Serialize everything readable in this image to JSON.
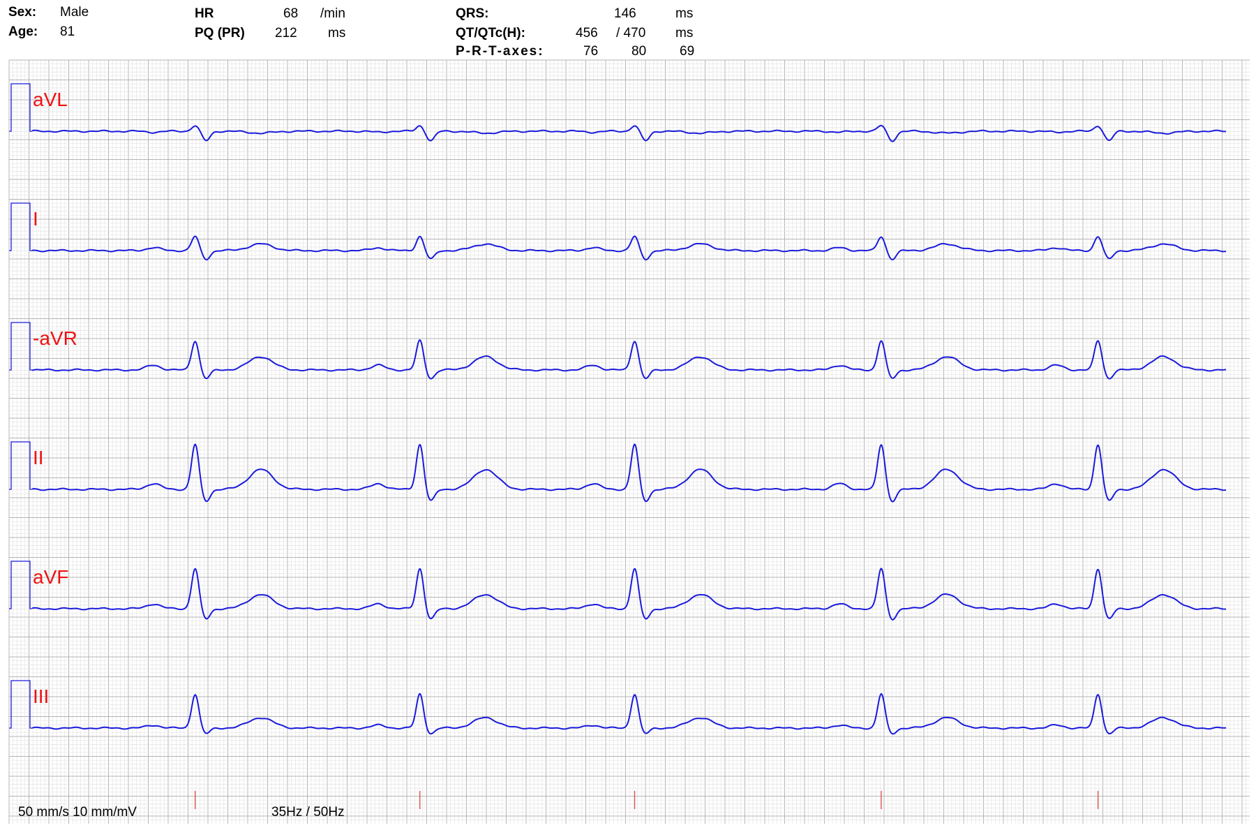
{
  "patient": {
    "sex_label": "Sex:",
    "sex": "Male",
    "age_label": "Age:",
    "age": "81"
  },
  "measurements": {
    "hr_label": "HR",
    "hr": "68",
    "hr_unit": "/min",
    "pq_label": "PQ (PR)",
    "pq": "212",
    "pq_unit": "ms",
    "qrs_label": "QRS:",
    "qrs": "146",
    "qrs_unit": "ms",
    "qt_label": "QT/QTc(H):",
    "qt": "456",
    "qtc": "/ 470",
    "qt_unit": "ms",
    "axes_label": "P-R-T-axes:",
    "p_axis": "76",
    "r_axis": "80",
    "t_axis": "69"
  },
  "footer": {
    "speed_gain": "50 mm/s 10 mm/mV",
    "filter": "35Hz / 50Hz"
  },
  "colors": {
    "trace": "#1a1adc",
    "label": "#ee1111",
    "grid_minor": "#e3e3e3",
    "grid_major": "#b4b4b4",
    "marker": "#e04848"
  },
  "chart_data": {
    "type": "line",
    "title": "",
    "paper_speed_mm_per_s": 50,
    "gain_mm_per_mV": 10,
    "duration_s": 6.0,
    "calibration_mV": 1.0,
    "beat_times_s": [
      0.82,
      1.95,
      3.03,
      4.27,
      5.36
    ],
    "qrs_onset_offsets_s": [
      0.0,
      0.0,
      0.0,
      0.0,
      0.0
    ],
    "leads": [
      {
        "name": "aVL",
        "r_mV": 0.12,
        "s_mV": -0.2,
        "t_mV": -0.04,
        "p_mV": -0.02
      },
      {
        "name": "I",
        "r_mV": 0.3,
        "s_mV": -0.18,
        "t_mV": 0.14,
        "p_mV": 0.06
      },
      {
        "name": "-aVR",
        "r_mV": 0.62,
        "s_mV": -0.18,
        "t_mV": 0.28,
        "p_mV": 0.1
      },
      {
        "name": "II",
        "r_mV": 0.95,
        "s_mV": -0.25,
        "t_mV": 0.42,
        "p_mV": 0.12
      },
      {
        "name": "aVF",
        "r_mV": 0.85,
        "s_mV": -0.22,
        "t_mV": 0.3,
        "p_mV": 0.1
      },
      {
        "name": "III",
        "r_mV": 0.72,
        "s_mV": -0.12,
        "t_mV": 0.22,
        "p_mV": 0.06
      }
    ],
    "grid": true
  }
}
